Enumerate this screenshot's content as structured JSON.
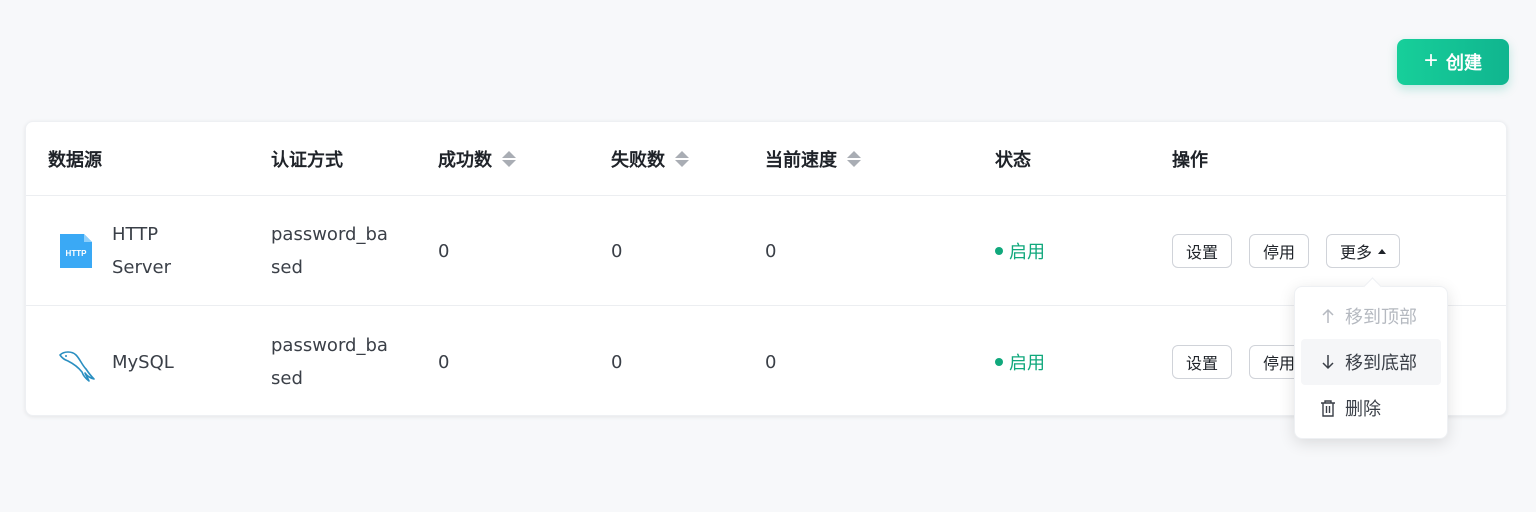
{
  "toolbar": {
    "create_label": "创建",
    "create_icon": "plus-icon"
  },
  "table": {
    "headers": {
      "source": "数据源",
      "auth": "认证方式",
      "success": "成功数",
      "fail": "失败数",
      "speed": "当前速度",
      "status": "状态",
      "actions": "操作"
    },
    "rows": [
      {
        "icon": "http-server-icon",
        "source_line1": "HTTP",
        "source_line2": "Server",
        "auth_line1": "password_ba",
        "auth_line2": "sed",
        "success": "0",
        "fail": "0",
        "speed": "0",
        "status": "启用",
        "btn_settings": "设置",
        "btn_disable": "停用",
        "btn_more": "更多"
      },
      {
        "icon": "mysql-icon",
        "source": "MySQL",
        "auth_line1": "password_ba",
        "auth_line2": "sed",
        "success": "0",
        "fail": "0",
        "speed": "0",
        "status": "启用",
        "btn_settings": "设置",
        "btn_disable": "停用"
      }
    ]
  },
  "dropdown": {
    "items": [
      {
        "label": "移到顶部",
        "icon": "arrow-up-icon",
        "disabled": true
      },
      {
        "label": "移到底部",
        "icon": "arrow-down-icon",
        "disabled": false
      },
      {
        "label": "删除",
        "icon": "trash-icon",
        "disabled": false
      }
    ]
  },
  "colors": {
    "accent": "#10b58f",
    "status_enabled": "#10a87c"
  }
}
